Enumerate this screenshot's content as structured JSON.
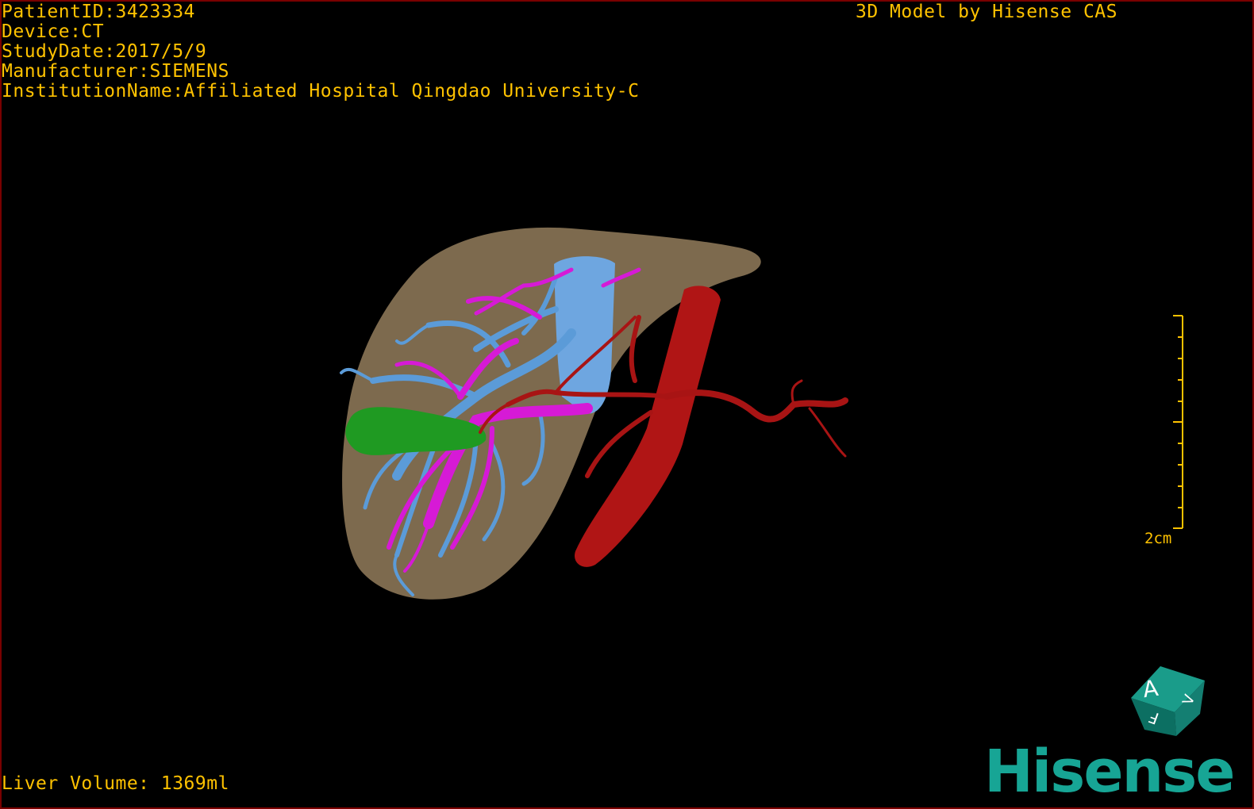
{
  "header": {
    "patient_id": "PatientID:3423334",
    "device": "Device:CT",
    "study_date": "StudyDate:2017/5/9",
    "manufacturer": "Manufacturer:SIEMENS",
    "institution": "InstitutionName:Affiliated Hospital Qingdao University-C",
    "model_credit": "3D Model by Hisense CAS"
  },
  "footer": {
    "liver_volume": "Liver Volume: 1369ml"
  },
  "scale_bar": {
    "label": "2cm"
  },
  "orientation_cube": {
    "faces": [
      "A",
      "F",
      "V"
    ]
  },
  "brand": {
    "logo_text": "Hisense"
  },
  "colors": {
    "overlay_text": "#ffc200",
    "liver": "#7d6a4e",
    "portal_vein": "#5b9bd8",
    "hepatic_vein": "#d61ad6",
    "artery": "#b01515",
    "gallbladder": "#1f9a22",
    "frame": "#7a0000",
    "brand": "#17a595"
  }
}
